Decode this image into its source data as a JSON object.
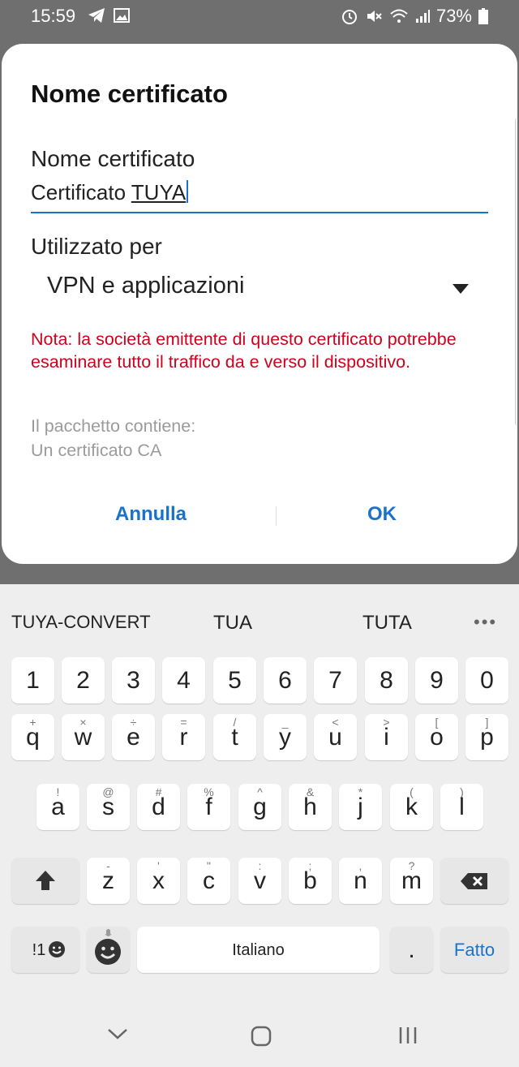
{
  "status_bar": {
    "time": "15:59",
    "battery": "73%",
    "icons_left": [
      "telegram-icon",
      "image-icon"
    ],
    "icons_right": [
      "alarm-icon",
      "mute-icon",
      "wifi-icon",
      "signal-icon",
      "battery-icon"
    ]
  },
  "dialog": {
    "title": "Nome certificato",
    "name_label": "Nome certificato",
    "name_value_plain": "Certificato ",
    "name_value_underlined": "TUYA",
    "used_for_label": "Utilizzato per",
    "used_for_value": "VPN e applicazioni",
    "note": "Nota: la società emittente di questo certificato potrebbe esaminare tutto il traffico da e verso il dispositivo.",
    "package_line1": "Il pacchetto contiene:",
    "package_line2": "Un certificato CA",
    "cancel": "Annulla",
    "ok": "OK"
  },
  "keyboard": {
    "suggestions": [
      "TUYA-CONVERT",
      "TUA",
      "TUTA"
    ],
    "more": "•••",
    "numbers": [
      "1",
      "2",
      "3",
      "4",
      "5",
      "6",
      "7",
      "8",
      "9",
      "0"
    ],
    "row1": [
      {
        "k": "q",
        "s": "+"
      },
      {
        "k": "w",
        "s": "×"
      },
      {
        "k": "e",
        "s": "÷"
      },
      {
        "k": "r",
        "s": "="
      },
      {
        "k": "t",
        "s": "/"
      },
      {
        "k": "y",
        "s": "_"
      },
      {
        "k": "u",
        "s": "<"
      },
      {
        "k": "i",
        "s": ">"
      },
      {
        "k": "o",
        "s": "["
      },
      {
        "k": "p",
        "s": "]"
      }
    ],
    "row2": [
      {
        "k": "a",
        "s": "!"
      },
      {
        "k": "s",
        "s": "@"
      },
      {
        "k": "d",
        "s": "#"
      },
      {
        "k": "f",
        "s": "%"
      },
      {
        "k": "g",
        "s": "^"
      },
      {
        "k": "h",
        "s": "&"
      },
      {
        "k": "j",
        "s": "*"
      },
      {
        "k": "k",
        "s": "("
      },
      {
        "k": "l",
        "s": ")"
      }
    ],
    "row3": [
      {
        "k": "z",
        "s": "-"
      },
      {
        "k": "x",
        "s": "'"
      },
      {
        "k": "c",
        "s": "\""
      },
      {
        "k": "v",
        "s": ":"
      },
      {
        "k": "b",
        "s": ";"
      },
      {
        "k": "n",
        "s": ","
      },
      {
        "k": "m",
        "s": "?"
      }
    ],
    "symbols_key": "!1",
    "space": "Italiano",
    "period": ".",
    "done": "Fatto"
  },
  "colors": {
    "accent": "#1a73c9",
    "warning": "#d0021b",
    "muted": "#9b9b9b"
  }
}
